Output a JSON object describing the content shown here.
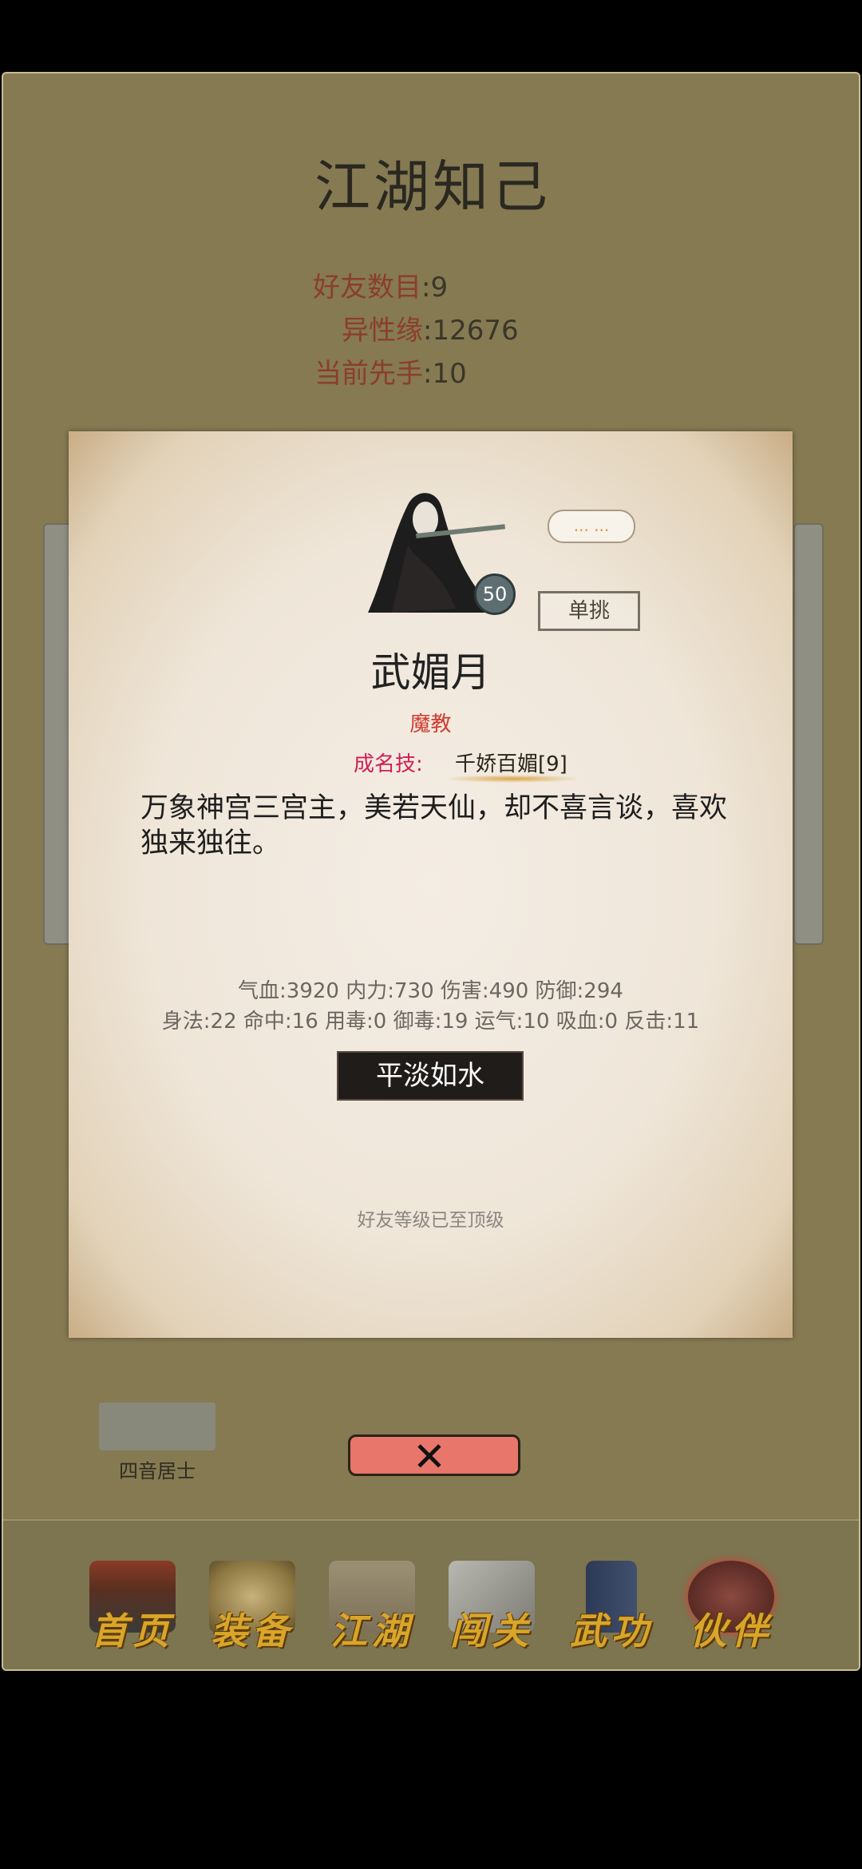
{
  "page_title": "江湖知己",
  "stats": [
    {
      "label": "好友数目",
      "value": ":9"
    },
    {
      "label": "异性缘",
      "value": ":12676"
    },
    {
      "label": "当前先手",
      "value": ":10"
    }
  ],
  "friend": {
    "name": "四音居士"
  },
  "dialog": {
    "level": "50",
    "bubble": "... ...",
    "duel_label": "单挑",
    "name": "武媚月",
    "faction": "魔教",
    "skill_label": "成名技:",
    "skill_value": "千娇百媚[9]",
    "description": "万象神宫三宫主，美若天仙，却不喜言谈，喜欢独来独往。",
    "stats_line1": "气血:3920  内力:730  伤害:490  防御:294",
    "stats_line2": "身法:22  命中:16  用毒:0  御毒:19  运气:10  吸血:0  反击:11",
    "relation_label": "平淡如水",
    "max_level_text": "好友等级已至顶级"
  },
  "close_icon": "close-x-icon",
  "nav": [
    {
      "label": "首页",
      "icon": "temple-icon"
    },
    {
      "label": "装备",
      "icon": "armor-icon"
    },
    {
      "label": "江湖",
      "icon": "scroll-map-icon"
    },
    {
      "label": "闯关",
      "icon": "crossed-swords-icon"
    },
    {
      "label": "武功",
      "icon": "book-icon"
    },
    {
      "label": "伙伴",
      "icon": "companions-icon"
    }
  ],
  "colors": {
    "background": "#857a52",
    "accent_red": "#d03a2f",
    "nav_label": "#d9a52a",
    "close_button": "#e8766a"
  }
}
